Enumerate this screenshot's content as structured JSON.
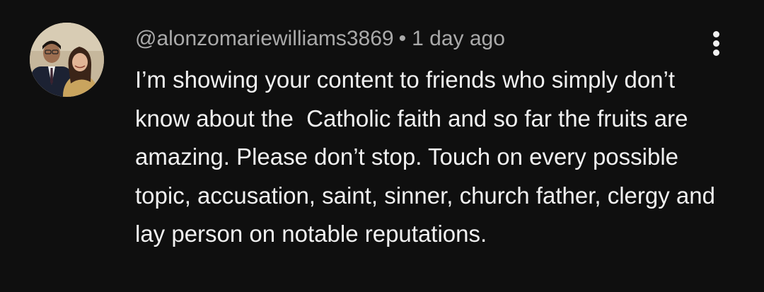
{
  "comment": {
    "author_handle": "@alonzomariewilliams3869",
    "separator": "•",
    "timestamp": "1 day ago",
    "text": "I’m showing your content to friends who simply don’t know about the  Catholic faith and so far the fruits are amazing. Please don’t stop. Touch on every possible topic, accusation, saint, sinner, church father, clergy and lay person on notable reputations.",
    "avatar_icon": "avatar-photo",
    "menu_icon": "more-vertical-icon"
  },
  "colors": {
    "background": "#0f0f0f",
    "primary_text": "#f1f1f1",
    "secondary_text": "#aaaaaa"
  }
}
